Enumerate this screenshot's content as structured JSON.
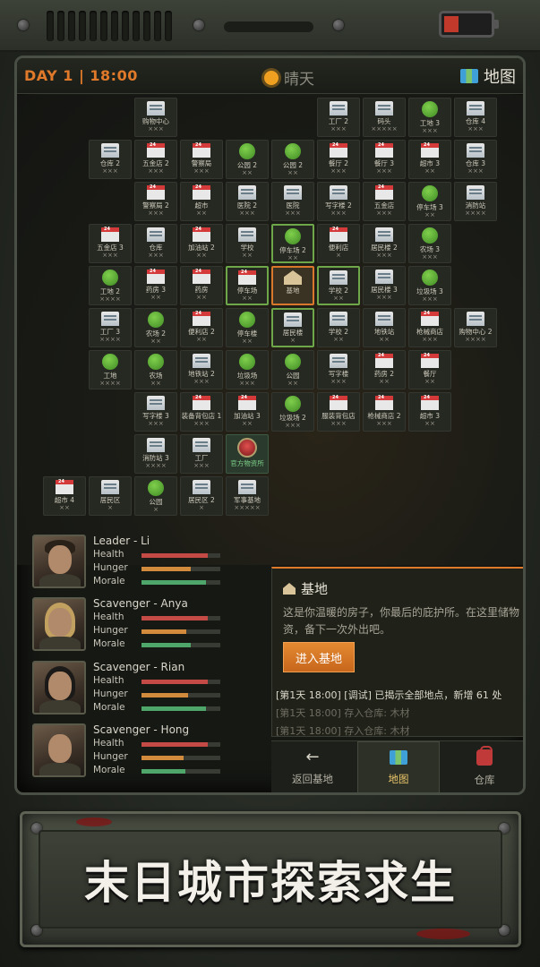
{
  "status": {
    "day": "DAY 1 | 18:00",
    "weather": "晴天",
    "map_label": "地图"
  },
  "map_tiles": [
    {
      "name": "购物中心",
      "status": "×××",
      "icon": "bld"
    },
    {
      "name": "工厂 2",
      "status": "×××",
      "icon": "bld"
    },
    {
      "name": "码头",
      "status": "×××××",
      "icon": "bld"
    },
    {
      "name": "工地 3",
      "status": "×××",
      "icon": "tree"
    },
    {
      "name": "仓库 4",
      "status": "×××",
      "icon": "bld"
    },
    {
      "name": "仓库 2",
      "status": "×××",
      "icon": "bld"
    },
    {
      "name": "五金店 2",
      "status": "×××",
      "icon": "shop"
    },
    {
      "name": "警察局",
      "status": "×××",
      "icon": "shop"
    },
    {
      "name": "公园 2",
      "status": "××",
      "icon": "tree"
    },
    {
      "name": "公园 2",
      "status": "××",
      "icon": "tree"
    },
    {
      "name": "餐厅 2",
      "status": "×××",
      "icon": "shop"
    },
    {
      "name": "餐厅 3",
      "status": "×××",
      "icon": "shop"
    },
    {
      "name": "超市 3",
      "status": "××",
      "icon": "shop"
    },
    {
      "name": "仓库 3",
      "status": "×××",
      "icon": "bld"
    },
    {
      "name": "警察局 2",
      "status": "×××",
      "icon": "shop"
    },
    {
      "name": "超市",
      "status": "××",
      "icon": "shop"
    },
    {
      "name": "医院 2",
      "status": "×××",
      "icon": "bld"
    },
    {
      "name": "医院",
      "status": "×××",
      "icon": "bld"
    },
    {
      "name": "写字楼 2",
      "status": "×××",
      "icon": "bld"
    },
    {
      "name": "五金店",
      "status": "×××",
      "icon": "shop"
    },
    {
      "name": "停车场 3",
      "status": "××",
      "icon": "tree"
    },
    {
      "name": "消防站",
      "status": "××××",
      "icon": "bld"
    },
    {
      "name": "五金店 3",
      "status": "×××",
      "icon": "shop"
    },
    {
      "name": "仓库",
      "status": "×××",
      "icon": "bld"
    },
    {
      "name": "加油站 2",
      "status": "××",
      "icon": "shop"
    },
    {
      "name": "学校",
      "status": "××",
      "icon": "bld"
    },
    {
      "name": "停车场 2",
      "status": "××",
      "icon": "tree"
    },
    {
      "name": "便利店",
      "status": "×",
      "icon": "shop"
    },
    {
      "name": "居民楼 2",
      "status": "×××",
      "icon": "bld"
    },
    {
      "name": "农场 3",
      "status": "×××",
      "icon": "tree"
    },
    {
      "name": "工地 2",
      "status": "××××",
      "icon": "tree"
    },
    {
      "name": "药房 3",
      "status": "××",
      "icon": "shop"
    },
    {
      "name": "药房",
      "status": "××",
      "icon": "shop"
    },
    {
      "name": "停车场",
      "status": "××",
      "icon": "shop"
    },
    {
      "name": "基地",
      "status": "",
      "icon": "home"
    },
    {
      "name": "学校 2",
      "status": "××",
      "icon": "bld"
    },
    {
      "name": "居民楼 3",
      "status": "×××",
      "icon": "bld"
    },
    {
      "name": "垃圾场 3",
      "status": "×××",
      "icon": "tree"
    },
    {
      "name": "工厂 3",
      "status": "××××",
      "icon": "bld"
    },
    {
      "name": "农场 2",
      "status": "××",
      "icon": "tree"
    },
    {
      "name": "便利店 2",
      "status": "××",
      "icon": "shop"
    },
    {
      "name": "停车楼",
      "status": "××",
      "icon": "tree"
    },
    {
      "name": "居民楼",
      "status": "×",
      "icon": "bld"
    },
    {
      "name": "学校 2",
      "status": "××",
      "icon": "bld"
    },
    {
      "name": "地铁站",
      "status": "××",
      "icon": "bld"
    },
    {
      "name": "枪械商店",
      "status": "×××",
      "icon": "shop"
    },
    {
      "name": "购物中心 2",
      "status": "××××",
      "icon": "bld"
    },
    {
      "name": "工地",
      "status": "××××",
      "icon": "tree"
    },
    {
      "name": "农场",
      "status": "××",
      "icon": "tree"
    },
    {
      "name": "地铁站 2",
      "status": "×××",
      "icon": "bld"
    },
    {
      "name": "垃圾场",
      "status": "×××",
      "icon": "tree"
    },
    {
      "name": "公园",
      "status": "××",
      "icon": "tree"
    },
    {
      "name": "写字楼",
      "status": "×××",
      "icon": "bld"
    },
    {
      "name": "药房 2",
      "status": "××",
      "icon": "shop"
    },
    {
      "name": "餐厅",
      "status": "××",
      "icon": "shop"
    },
    {
      "name": "写字楼 3",
      "status": "×××",
      "icon": "bld"
    },
    {
      "name": "装备背包店 1",
      "status": "×××",
      "icon": "shop"
    },
    {
      "name": "加油站 3",
      "status": "××",
      "icon": "shop"
    },
    {
      "name": "垃圾场 2",
      "status": "×××",
      "icon": "tree"
    },
    {
      "name": "服装背包店",
      "status": "×××",
      "icon": "shop"
    },
    {
      "name": "枪械商店 2",
      "status": "×××",
      "icon": "shop"
    },
    {
      "name": "超市 3",
      "status": "××",
      "icon": "shop"
    },
    {
      "name": "消防站 3",
      "status": "××××",
      "icon": "bld"
    },
    {
      "name": "工厂",
      "status": "×××",
      "icon": "bld"
    },
    {
      "name": "官方物资所",
      "status": "",
      "icon": "badge"
    },
    {
      "name": "超市 4",
      "status": "××",
      "icon": "shop"
    },
    {
      "name": "居民区",
      "status": "×",
      "icon": "bld"
    },
    {
      "name": "公园",
      "status": "×",
      "icon": "tree"
    },
    {
      "name": "居民区 2",
      "status": "×",
      "icon": "bld"
    },
    {
      "name": "军事基地",
      "status": "×××××",
      "icon": "bld"
    }
  ],
  "characters": [
    {
      "name": "Leader - Li",
      "health_label": "Health",
      "hunger_label": "Hunger",
      "morale_label": "Morale",
      "health": 0.84,
      "hunger": 0.62,
      "morale": 0.82
    },
    {
      "name": "Scavenger - Anya",
      "health_label": "Health",
      "hunger_label": "Hunger",
      "morale_label": "Morale",
      "health": 0.84,
      "hunger": 0.57,
      "morale": 0.62
    },
    {
      "name": "Scavenger - Rian",
      "health_label": "Health",
      "hunger_label": "Hunger",
      "morale_label": "Morale",
      "health": 0.84,
      "hunger": 0.59,
      "morale": 0.82
    },
    {
      "name": "Scavenger - Hong",
      "health_label": "Health",
      "hunger_label": "Hunger",
      "morale_label": "Morale",
      "health": 0.84,
      "hunger": 0.53,
      "morale": 0.56
    }
  ],
  "panel": {
    "title": "基地",
    "description": "这是你温暖的房子，你最后的庇护所。在这里储物资，备下一次外出吧。",
    "enter_button": "进入基地",
    "log": [
      "[第1天 18:00] [调试] 已揭示全部地点，新增 61 处",
      "[第1天 18:00] 存入仓库: 木材",
      "[第1天 18:00] 存入仓库: 木材"
    ]
  },
  "nav": {
    "back": "返回基地",
    "map": "地图",
    "storage": "仓库"
  },
  "banner": {
    "slogan": "末日城市探索求生"
  }
}
